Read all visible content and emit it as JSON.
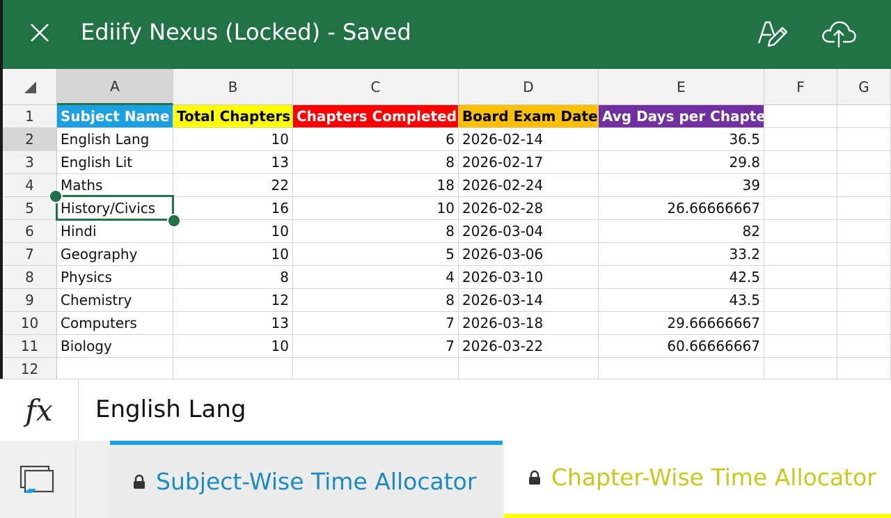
{
  "title_bar": {
    "title": "Ediify Nexus (Locked) - Saved"
  },
  "grid": {
    "columns": [
      "A",
      "B",
      "C",
      "D",
      "E",
      "F",
      "G"
    ],
    "rows": [
      "1",
      "2",
      "3",
      "4",
      "5",
      "6",
      "7",
      "8",
      "9",
      "10",
      "11",
      "12"
    ],
    "selected_cell": "A2",
    "headers": [
      {
        "text": "Subject Name",
        "fill": "#1ba1e2"
      },
      {
        "text": "Total Chapters",
        "fill": "#ffff00"
      },
      {
        "text": "Chapters Completed",
        "fill": "#ff0000"
      },
      {
        "text": "Board Exam Date",
        "fill": "#ffc000"
      },
      {
        "text": "Avg Days per Chapter",
        "fill": "#7030a0"
      }
    ],
    "data_rows": [
      [
        "English Lang",
        "10",
        "6",
        "2026-02-14",
        "36.5"
      ],
      [
        "English Lit",
        "13",
        "8",
        "2026-02-17",
        "29.8"
      ],
      [
        "Maths",
        "22",
        "18",
        "2026-02-24",
        "39"
      ],
      [
        "History/Civics",
        "16",
        "10",
        "2026-02-28",
        "26.66666667"
      ],
      [
        "Hindi",
        "10",
        "8",
        "2026-03-04",
        "82"
      ],
      [
        "Geography",
        "10",
        "5",
        "2026-03-06",
        "33.2"
      ],
      [
        "Physics",
        "8",
        "4",
        "2026-03-10",
        "42.5"
      ],
      [
        "Chemistry",
        "12",
        "8",
        "2026-03-14",
        "43.5"
      ],
      [
        "Computers",
        "13",
        "7",
        "2026-03-18",
        "29.66666667"
      ],
      [
        "Biology",
        "10",
        "7",
        "2026-03-22",
        "60.66666667"
      ]
    ]
  },
  "formula_bar": {
    "icon_label": "fx",
    "value": "English Lang"
  },
  "sheet_tabs": [
    {
      "label": "Subject-Wise Time Allocator",
      "color": "#1ba1e2",
      "active": false
    },
    {
      "label": "Chapter-Wise Time Allocator",
      "color": "#ffff00",
      "active": true
    }
  ],
  "icons": {
    "close": "close-icon",
    "edit": "edit-pen-icon",
    "cloud": "cloud-upload-icon",
    "sheets": "sheets-list-icon",
    "lock": "lock-icon",
    "select_all": "select-all-triangle-icon"
  },
  "colors": {
    "brand": "#217346"
  }
}
